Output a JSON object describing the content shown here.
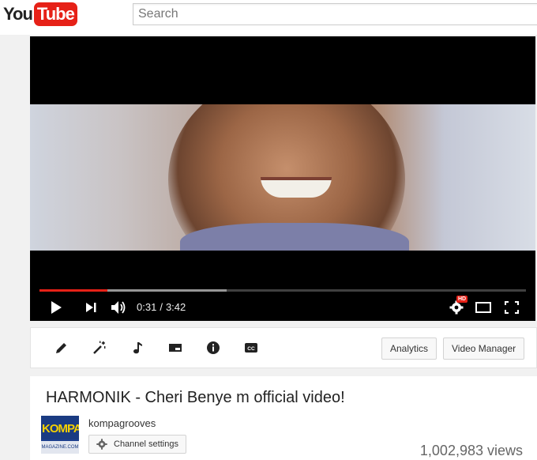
{
  "masthead": {
    "logo_you": "You",
    "logo_tube": "Tube",
    "search_placeholder": "Search"
  },
  "player": {
    "current_time": "0:31",
    "separator": "/",
    "duration": "3:42",
    "played_fraction": 0.14,
    "buffered_fraction": 0.385,
    "hd_badge": "HD",
    "icons": [
      "play-icon",
      "next-icon",
      "volume-icon",
      "settings-icon",
      "theater-mode-icon",
      "fullscreen-icon"
    ]
  },
  "toolbar": {
    "icons": [
      "edit-icon",
      "enhance-icon",
      "audio-icon",
      "end-screen-icon",
      "info-icon",
      "captions-icon"
    ],
    "analytics_label": "Analytics",
    "video_manager_label": "Video Manager"
  },
  "video": {
    "title": "HARMONIK - Cheri Benye m official video!",
    "channel_name": "kompagrooves",
    "avatar_text": "KOMPA",
    "avatar_subtext": "MAGAZINE.COM",
    "channel_settings_label": "Channel settings",
    "views": "1,002,983 views"
  },
  "colors": {
    "brand_red": "#e62117",
    "background": "#f1f1f1"
  }
}
